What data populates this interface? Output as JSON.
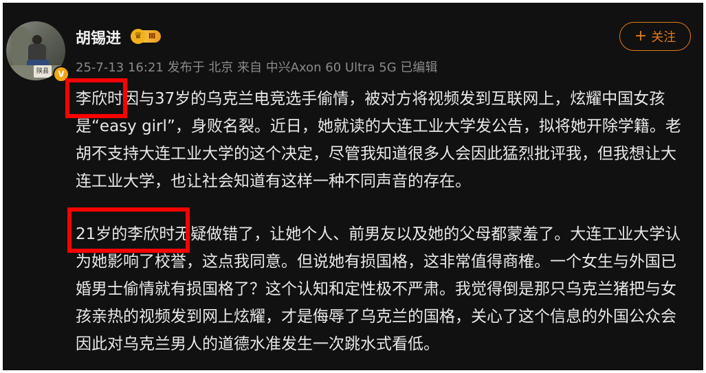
{
  "post": {
    "author": {
      "name": "胡锡进",
      "level_badge": "Ⅲ",
      "avatar_seal": "陕县",
      "verified_mark": "V"
    },
    "meta": "25-7-13 16:21 发布于 北京 来自 中兴Axon 60 Ultra 5G 已编辑",
    "follow_button": {
      "icon": "+",
      "label": "关注"
    },
    "paragraphs": [
      "李欣时因与37岁的乌克兰电竞选手偷情，被对方将视频发到互联网上，炫耀中国女孩是“easy girl”，身败名裂。近日，她就读的大连工业大学发公告，拟将她开除学籍。老胡不支持大连工业大学的这个决定，尽管我知道很多人会因此猛烈批评我，但我想让大连工业大学，也让社会知道有这样一种不同声音的存在。",
      "21岁的李欣时无疑做错了，让她个人、前男友以及她的父母都蒙羞了。大连工业大学认为她影响了校誉，这点我同意。但说她有损国格，这非常值得商榷。一个女生与外国已婚男士偷情就有损国格了？这个认知和定性极不严肃。我觉得倒是那只乌克兰猪把与女孩亲热的视频发到网上炫耀，才是侮辱了乌克兰的国格，关心了这个信息的外国公众会因此对乌克兰男人的道德水准发生一次跳水式看低。"
    ]
  },
  "colors": {
    "background": "#111111",
    "text": "#e8e8e8",
    "meta": "#8a8a8a",
    "accent": "#e37b16",
    "highlight": "#ff0000"
  }
}
